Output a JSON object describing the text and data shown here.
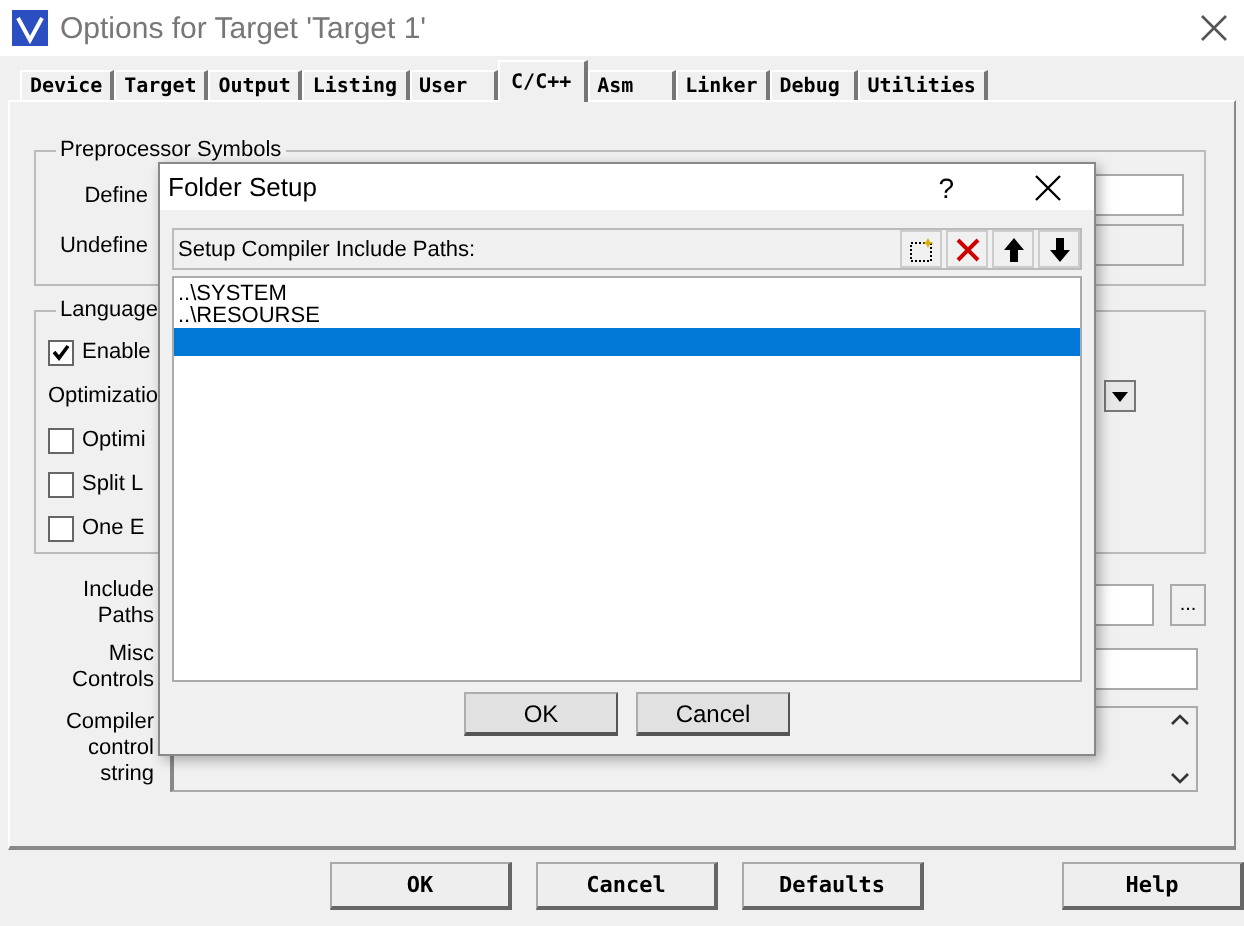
{
  "window": {
    "title": "Options for Target 'Target 1'"
  },
  "tabs": [
    {
      "label": "Device",
      "selected": false
    },
    {
      "label": "Target",
      "selected": false
    },
    {
      "label": "Output",
      "selected": false
    },
    {
      "label": "Listing",
      "selected": false
    },
    {
      "label": "User",
      "selected": false
    },
    {
      "label": "C/C++",
      "selected": true
    },
    {
      "label": "Asm",
      "selected": false
    },
    {
      "label": "Linker",
      "selected": false
    },
    {
      "label": "Debug",
      "selected": false
    },
    {
      "label": "Utilities",
      "selected": false
    }
  ],
  "preprocessor": {
    "title": "Preprocessor Symbols",
    "define_label": "Define",
    "undefine_label": "Undefine"
  },
  "language": {
    "title": "Language",
    "options": [
      {
        "label": "Enable",
        "checked": true
      }
    ],
    "optimization_label": "Optimizatio",
    "flags": [
      {
        "label": "Optimi",
        "checked": false
      },
      {
        "label": "Split L",
        "checked": false
      },
      {
        "label": "One E",
        "checked": false
      }
    ]
  },
  "include_paths": {
    "label_lines": [
      "Include",
      "Paths"
    ],
    "browse": "..."
  },
  "misc_controls": {
    "label_lines": [
      "Misc",
      "Controls"
    ]
  },
  "compiler_string": {
    "label_lines": [
      "Compiler",
      "control",
      "string"
    ]
  },
  "buttons": [
    "OK",
    "Cancel",
    "Defaults",
    "Help"
  ],
  "folder_dialog": {
    "title": "Folder Setup",
    "help": "?",
    "header": "Setup Compiler Include Paths:",
    "paths": [
      {
        "text": "..\\SYSTEM",
        "selected": false
      },
      {
        "text": "..\\RESOURSE",
        "selected": false
      }
    ],
    "blank_row": {
      "selected": true
    },
    "buttons": [
      "OK",
      "Cancel"
    ]
  }
}
